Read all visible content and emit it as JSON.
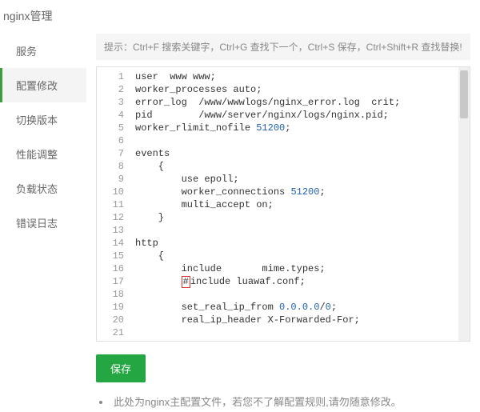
{
  "header": {
    "title": "nginx管理"
  },
  "sidebar": {
    "items": [
      {
        "label": "服务",
        "key": "service"
      },
      {
        "label": "配置修改",
        "key": "config",
        "active": true
      },
      {
        "label": "切换版本",
        "key": "version"
      },
      {
        "label": "性能调整",
        "key": "perf"
      },
      {
        "label": "负载状态",
        "key": "load"
      },
      {
        "label": "错误日志",
        "key": "errorlog"
      }
    ]
  },
  "tip": "提示：Ctrl+F 搜索关键字，Ctrl+G 查找下一个，Ctrl+S 保存，Ctrl+Shift+R 查找替换!",
  "editor": {
    "visible_line_start": 1,
    "highlight": {
      "line": 17,
      "text": "#"
    },
    "lines": [
      [
        "user  www www;"
      ],
      [
        "worker_processes auto;"
      ],
      [
        "error_log  /www/wwwlogs/nginx_error.log  crit;"
      ],
      [
        "pid        /www/server/nginx/logs/nginx.pid;"
      ],
      [
        "worker_rlimit_nofile ",
        {
          "num": "51200"
        },
        ";"
      ],
      [
        ""
      ],
      [
        "events"
      ],
      [
        "    {"
      ],
      [
        "        use epoll;"
      ],
      [
        "        worker_connections ",
        {
          "num": "51200"
        },
        ";"
      ],
      [
        "        multi_accept on;"
      ],
      [
        "    }"
      ],
      [
        ""
      ],
      [
        "http"
      ],
      [
        "    {"
      ],
      [
        "        include       mime.types;"
      ],
      [
        "        ",
        {
          "hl": "#"
        },
        "include luawaf.conf;"
      ],
      [
        ""
      ],
      [
        "        set_real_ip_from ",
        {
          "num": "0.0.0.0"
        },
        "/",
        {
          "num": "0"
        },
        ";"
      ],
      [
        "        real_ip_header X-Forwarded-For;"
      ],
      [
        ""
      ]
    ]
  },
  "actions": {
    "save_label": "保存"
  },
  "note": "此处为nginx主配置文件，若您不了解配置规则,请勿随意修改。"
}
